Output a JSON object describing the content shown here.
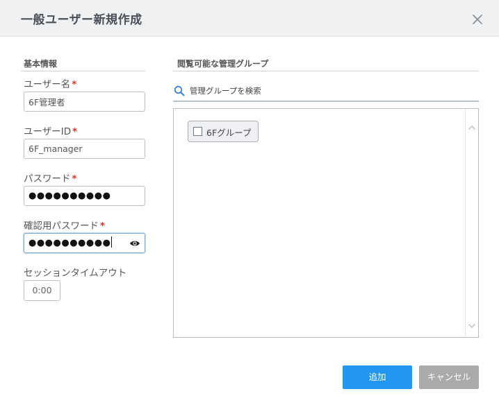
{
  "dialog": {
    "title": "一般ユーザー新規作成",
    "close_icon": "close-icon"
  },
  "basic_info": {
    "section_title": "基本情報",
    "username": {
      "label": "ユーザー名",
      "required_mark": "*",
      "value": "6F管理者"
    },
    "user_id": {
      "label": "ユーザーID",
      "required_mark": "*",
      "value": "6F_manager"
    },
    "password": {
      "label": "パスワード",
      "required_mark": "*",
      "masked_value": "●●●●●●●●●●"
    },
    "confirm_password": {
      "label": "確認用パスワード",
      "required_mark": "*",
      "masked_value": "●●●●●●●●●●",
      "reveal_icon": "eye-icon"
    },
    "session_timeout": {
      "label": "セッションタイムアウト",
      "value": "0:00"
    }
  },
  "groups": {
    "section_title": "閲覧可能な管理グループ",
    "search": {
      "placeholder": "管理グループを検索",
      "icon": "search-icon"
    },
    "items": [
      {
        "label": "6Fグループ",
        "checked": false
      }
    ]
  },
  "footer": {
    "add_label": "追加",
    "cancel_label": "キャンセル"
  },
  "colors": {
    "primary": "#2196f3",
    "secondary": "#aaaaaa",
    "required": "#d9342b",
    "header_bg": "#f0f1f3"
  }
}
